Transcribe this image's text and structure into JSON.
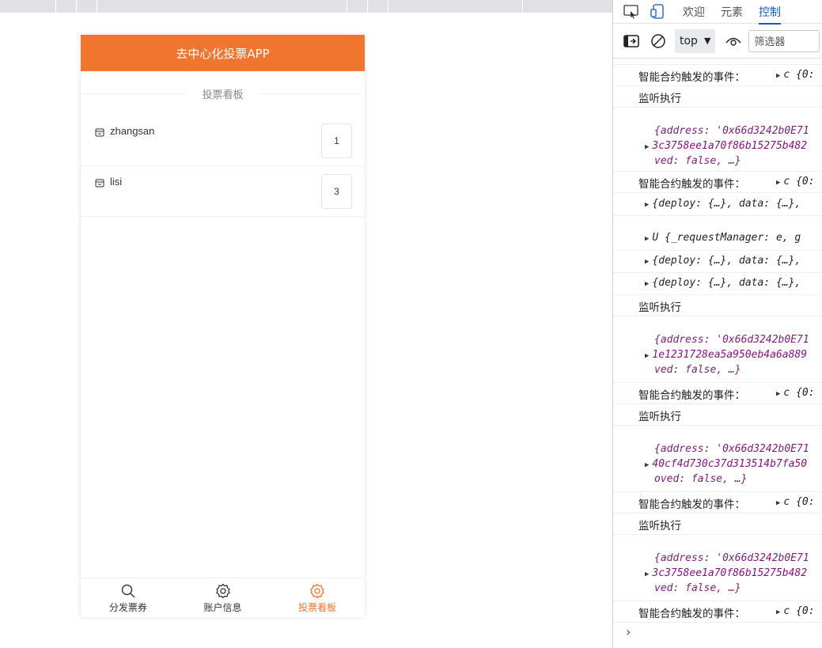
{
  "app": {
    "title": "去中心化投票APP",
    "section_title": "投票看板",
    "candidates": [
      {
        "name": "zhangsan",
        "votes": "1"
      },
      {
        "name": "lisi",
        "votes": "3"
      }
    ],
    "tabs": [
      {
        "label": "分发票券",
        "icon": "search-icon",
        "active": false
      },
      {
        "label": "账户信息",
        "icon": "gear-icon",
        "active": false
      },
      {
        "label": "投票看板",
        "icon": "gear-icon",
        "active": true
      }
    ],
    "accent_color": "#f07630"
  },
  "devtools": {
    "tabs": [
      "欢迎",
      "元素",
      "控制"
    ],
    "context": "top",
    "filter_placeholder": "筛选器",
    "lines": {
      "evt_label": "智能合约触发的事件：",
      "evt_obj": "c {0:",
      "listen": "监听执行",
      "address_label": "{address: '0x66d3242b0E71",
      "hash1": "3c3758ee1a70f86b15275b482",
      "hash2": "1e1231728ea5a950eb4a6a889",
      "hash3": "40cf4d730c37d313514b7fa50",
      "removed1": "ved: false, …}",
      "removed2": "oved: false, …}",
      "deploy": "{deploy: {…}, data: {…},",
      "request": "U {_requestManager: e, g"
    }
  }
}
